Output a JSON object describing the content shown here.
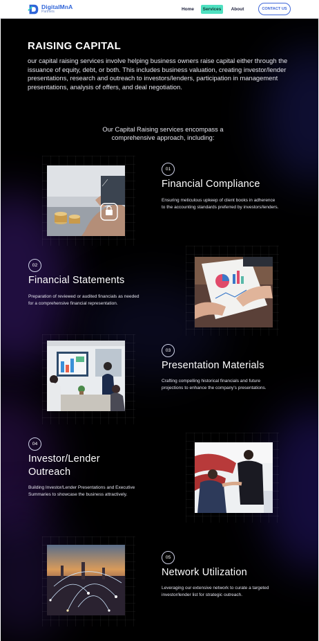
{
  "header": {
    "logo_name": "DigitalMnA",
    "logo_sub": "Partners",
    "nav": {
      "home": "Home",
      "services": "Services",
      "about": "About"
    },
    "contact_label": "CONTACT US",
    "accent": "#4fe0c0",
    "brand": "#2f64d8"
  },
  "hero": {
    "title": "RAISING CAPITAL",
    "text": "our capital raising services involve helping business owners raise capital either through the issuance of equity, debt, or both. This includes business valuation, creating investor/lender presentations, research and outreach to investors/lenders, participation in management presentations, analysis of offers, and deal negotiation."
  },
  "intro": "Our Capital Raising services encompass a comprehensive approach, including:",
  "services": [
    {
      "num": "01",
      "title": "Financial Compliance",
      "desc": "Ensuring meticulous upkeep of client books in adherence to the accounting standards preferred by investors/lenders.",
      "image": "coins-lock-icon"
    },
    {
      "num": "02",
      "title": "Financial Statements",
      "desc": "Preparation of reviewed or audited financials as needed for a comprehensive financial representation.",
      "image": "charts-paperwork"
    },
    {
      "num": "03",
      "title": "Presentation Materials",
      "desc": "Crafting compelling historical financials and future projections to enhance the company's presentations.",
      "image": "meeting-room"
    },
    {
      "num": "04",
      "title_line1": "Investor/Lender",
      "title_line2": "Outreach",
      "desc": "Building Investor/Lender Presentations and Executive Summaries to showcase the business attractively.",
      "image": "handshake"
    },
    {
      "num": "05",
      "title": "Network Utilization",
      "desc": "Leveraging our extensive network to curate a targeted investor/lender list for strategic outreach.",
      "image": "city-network"
    }
  ]
}
